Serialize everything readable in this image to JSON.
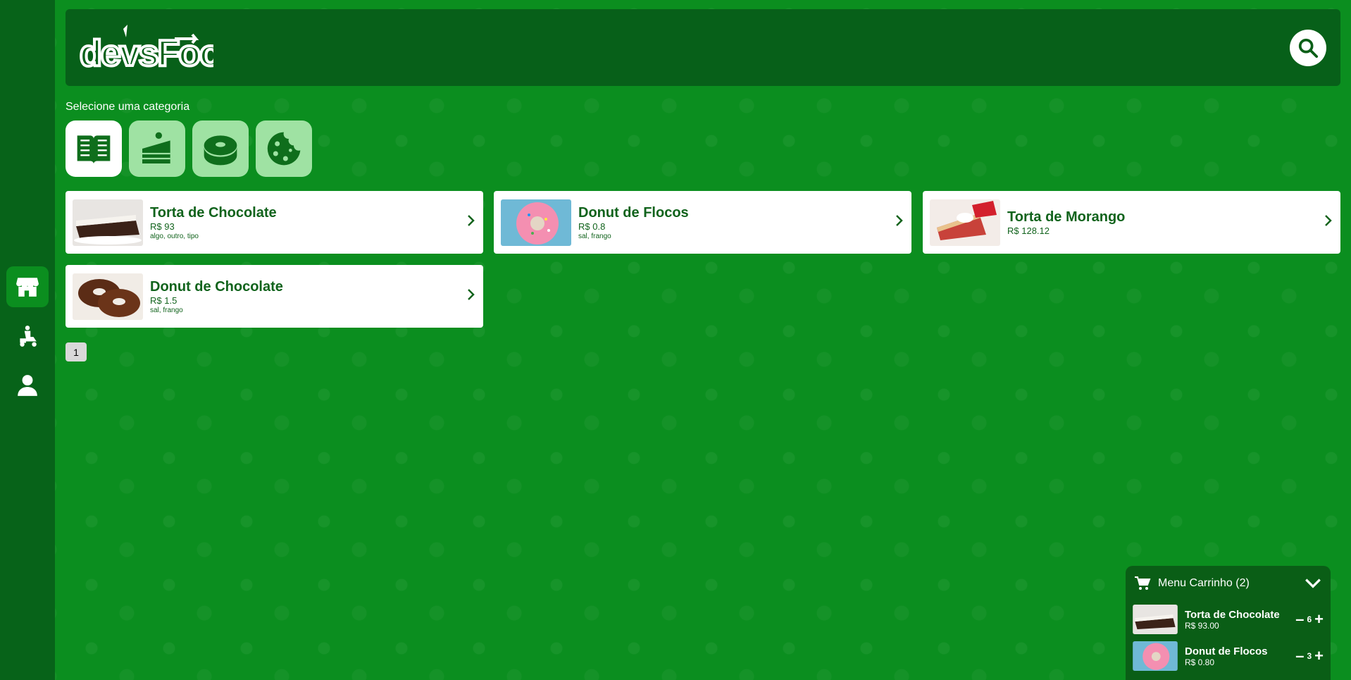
{
  "header": {
    "logo_text": "devsFood"
  },
  "categories_title": "Selecione uma categoria",
  "categories": [
    {
      "name": "book-icon"
    },
    {
      "name": "cake-icon"
    },
    {
      "name": "donut-icon"
    },
    {
      "name": "cookie-icon"
    }
  ],
  "products": [
    {
      "name": "Torta de Chocolate",
      "price": "R$ 93",
      "ingredients": "algo, outro, tipo"
    },
    {
      "name": "Donut de Flocos",
      "price": "R$ 0.8",
      "ingredients": "sal, frango"
    },
    {
      "name": "Torta de Morango",
      "price": "R$ 128.12",
      "ingredients": ""
    },
    {
      "name": "Donut de Chocolate",
      "price": "R$ 1.5",
      "ingredients": "sal, frango"
    }
  ],
  "pagination": {
    "current": "1"
  },
  "cart": {
    "title": "Menu Carrinho (2)",
    "items": [
      {
        "name": "Torta de Chocolate",
        "price": "R$ 93.00",
        "qty": "6"
      },
      {
        "name": "Donut de Flocos",
        "price": "R$ 0.80",
        "qty": "3"
      }
    ]
  },
  "colors": {
    "sidebar": "#076319",
    "background": "#0b8e1f",
    "header": "#076019",
    "accent": "#11631c"
  }
}
